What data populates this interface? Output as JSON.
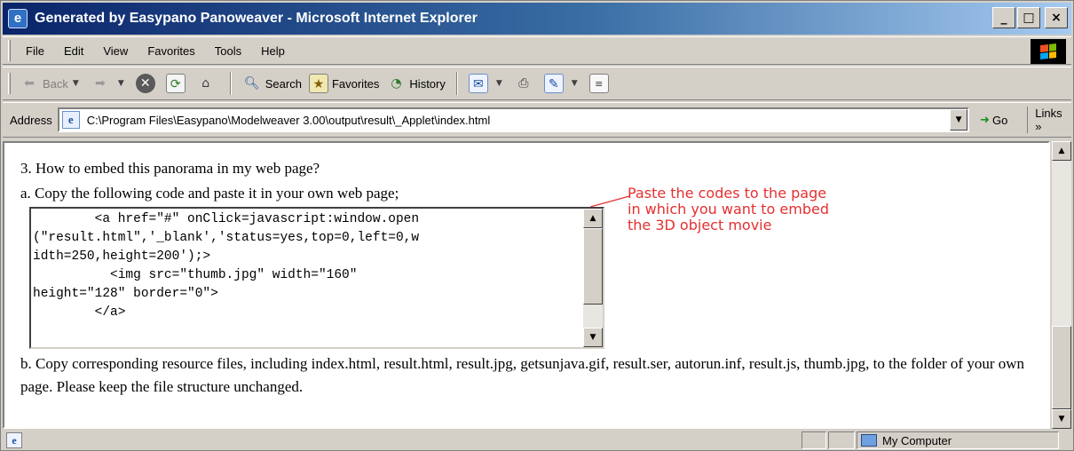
{
  "window": {
    "title": "Generated by Easypano Panoweaver - Microsoft Internet Explorer",
    "buttons": {
      "minimize": "_",
      "maximize": "□",
      "close": "×"
    }
  },
  "menubar": {
    "items": [
      "File",
      "Edit",
      "View",
      "Favorites",
      "Tools",
      "Help"
    ]
  },
  "toolbar": {
    "back": "Back",
    "search": "Search",
    "favorites": "Favorites",
    "history": "History"
  },
  "addressbar": {
    "label": "Address",
    "url": "C:\\Program Files\\Easypano\\Modelweaver 3.00\\output\\result\\_Applet\\index.html",
    "go": "Go",
    "links": "Links »"
  },
  "content": {
    "heading": "3. How to embed this panorama in my web page?",
    "step_a": "a. Copy the following code and paste it in your own web page;",
    "code": "        <a href=\"#\" onClick=javascript:window.open\n(\"result.html\",'_blank','status=yes,top=0,left=0,w\nidth=250,height=200');>\n          <img src=\"thumb.jpg\" width=\"160\"\nheight=\"128\" border=\"0\">\n        </a>",
    "step_b": "b. Copy corresponding resource files, including index.html, result.html, result.jpg, getsunjava.gif, result.ser, autorun.inf, result.js, thumb.jpg, to the folder of your own page. Please keep the file structure unchanged.",
    "annotation": [
      "Paste the codes to the page",
      "in which you want to embed",
      "the 3D object movie"
    ]
  },
  "statusbar": {
    "zone": "My Computer"
  },
  "colors": {
    "annotation": "#e53030",
    "titlebar_start": "#0a246a",
    "titlebar_end": "#a6caf0"
  },
  "icons": [
    "ie-logo-icon",
    "back-arrow-icon",
    "forward-arrow-icon",
    "stop-icon",
    "refresh-icon",
    "home-icon",
    "search-icon",
    "favorites-icon",
    "history-icon",
    "mail-icon",
    "print-icon",
    "edit-icon",
    "discuss-icon",
    "go-arrow-icon",
    "windows-logo-icon",
    "computer-icon"
  ]
}
